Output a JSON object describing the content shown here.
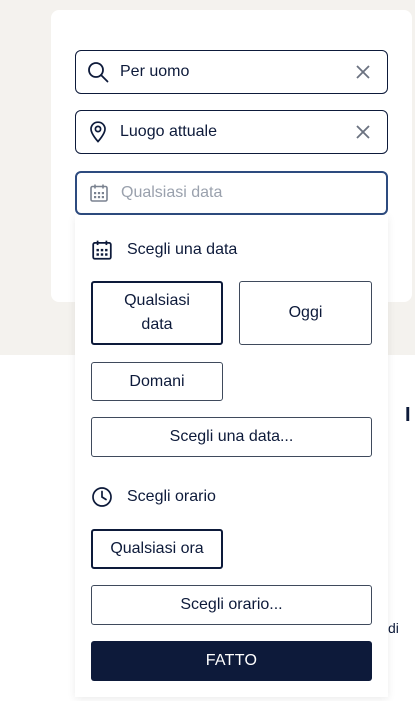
{
  "search": {
    "query_value": "Per uomo",
    "location_value": "Luogo attuale",
    "date_placeholder": "Qualsiasi data"
  },
  "date_section": {
    "title": "Scegli una data",
    "options": [
      "Qualsiasi data",
      "Oggi",
      "Domani"
    ],
    "selected": "Qualsiasi data",
    "choose_date_label": "Scegli una data..."
  },
  "time_section": {
    "title": "Scegli orario",
    "options": [
      "Qualsiasi ora"
    ],
    "selected": "Qualsiasi ora",
    "choose_time_label": "Scegli orario..."
  },
  "done_label": "FATTO",
  "background_fragments": {
    "right_top": "I",
    "right_bottom": "di"
  },
  "colors": {
    "primary": "#0d1a3a",
    "active_border": "#2d4b7f",
    "background": "#f4f2ee",
    "placeholder": "#9aa1ad"
  }
}
